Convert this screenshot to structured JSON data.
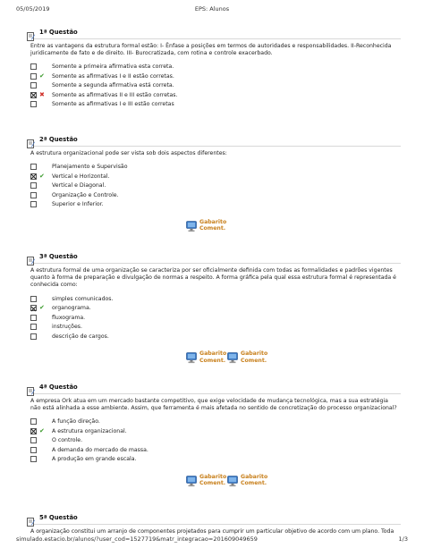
{
  "page": {
    "date": "05/05/2019",
    "title": "EPS: Alunos",
    "url": "simulado.estacio.br/alunos/?user_cod=1527719&matr_integracao=201609049659",
    "page_number": "1/3"
  },
  "icons": {
    "question": "pencil-paper-icon",
    "gabarito": "monitor-icon",
    "correct": "check-icon",
    "wrong": "x-icon"
  },
  "colors": {
    "correct": "#3a9a2b",
    "wrong": "#d0302a",
    "gabarito": "#c8801c"
  },
  "gabarito": {
    "line1": "Gabarito",
    "line2": "Coment."
  },
  "questions": [
    {
      "title": "1ª Questão",
      "text": "Entre as vantagens da estrutura formal estão: I- Ênfase a posições em termos de autoridades e responsabilidades. II-Reconhecida juridicamente de fato e de direito. III- Burocratizada, com rotina e controle exacerbado.",
      "options": [
        {
          "text": "Somente a primeira afirmativa esta correta.",
          "checked": false,
          "mark": ""
        },
        {
          "text": "Somente as afirmativas I e II estão corretas.",
          "checked": false,
          "mark": "correct"
        },
        {
          "text": "Somente a segunda afirmativa está correta.",
          "checked": false,
          "mark": ""
        },
        {
          "text": "Somente as afirmativas II e III estão corretas.",
          "checked": true,
          "mark": "wrong"
        },
        {
          "text": "Somente as afirmativas I e III estão corretas",
          "checked": false,
          "mark": ""
        }
      ],
      "gabarito_count": 0
    },
    {
      "title": "2ª Questão",
      "text": "A estrutura organizacional pode ser vista sob dois aspectos diferentes:",
      "options": [
        {
          "text": "Planejamento e Supervisão",
          "checked": false,
          "mark": ""
        },
        {
          "text": "Vertical e Horizontal.",
          "checked": true,
          "mark": "correct"
        },
        {
          "text": "Vertical e Diagonal.",
          "checked": false,
          "mark": ""
        },
        {
          "text": "Organização e Controle.",
          "checked": false,
          "mark": ""
        },
        {
          "text": "Superior e Inferior.",
          "checked": false,
          "mark": ""
        }
      ],
      "gabarito_count": 1
    },
    {
      "title": "3ª Questão",
      "text": "A estrutura formal de uma organização se caracteriza por ser oficialmente definida com todas as formalidades e padrões vigentes quanto à forma de preparação e divulgação de normas a respeito. A forma gráfica pela qual essa estrutura formal é representada é conhecida como:",
      "options": [
        {
          "text": "simples comunicados.",
          "checked": false,
          "mark": ""
        },
        {
          "text": "organograma.",
          "checked": true,
          "mark": "correct"
        },
        {
          "text": "fluxograma.",
          "checked": false,
          "mark": ""
        },
        {
          "text": "instruções.",
          "checked": false,
          "mark": ""
        },
        {
          "text": "descrição de cargos.",
          "checked": false,
          "mark": ""
        }
      ],
      "gabarito_count": 2
    },
    {
      "title": "4ª Questão",
      "text": "A empresa Ork atua em um mercado bastante competitivo, que exige velocidade de mudança tecnológica, mas a sua estratégia não está alinhada a esse ambiente. Assim, que ferramenta é mais afetada no sentido de concretização do processo organizacional?",
      "options": [
        {
          "text": "A função direção.",
          "checked": false,
          "mark": ""
        },
        {
          "text": "A estrutura organizacional.",
          "checked": true,
          "mark": "correct"
        },
        {
          "text": "O controle.",
          "checked": false,
          "mark": ""
        },
        {
          "text": "A demanda do mercado de massa.",
          "checked": false,
          "mark": ""
        },
        {
          "text": "A produção em grande escala.",
          "checked": false,
          "mark": ""
        }
      ],
      "gabarito_count": 2
    },
    {
      "title": "5ª Questão",
      "text": "A organização constitui um arranjo de componentes projetados para cumprir um particular objetivo de acordo com um plano. Toda",
      "options": [],
      "gabarito_count": 0
    }
  ]
}
